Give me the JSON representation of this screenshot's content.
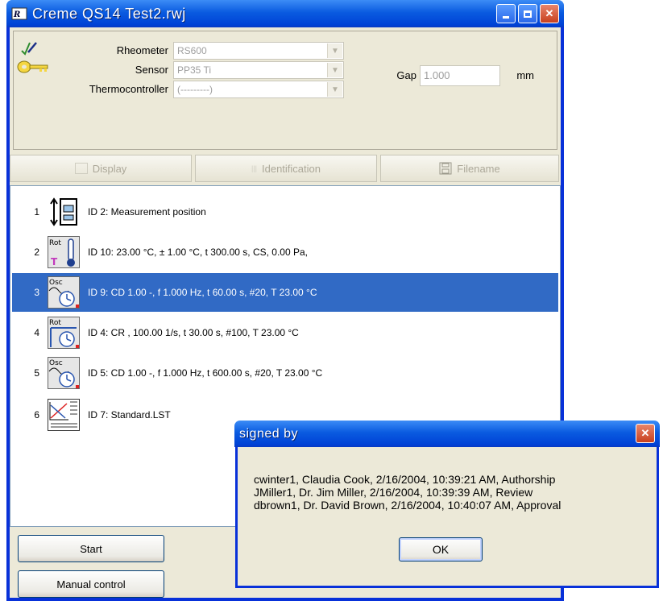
{
  "window": {
    "title": "Creme QS14 Test2.rwj"
  },
  "settings": {
    "rheometer_label": "Rheometer",
    "rheometer_value": "RS600",
    "sensor_label": "Sensor",
    "sensor_value": "PP35 Ti",
    "thermo_label": "Thermocontroller",
    "thermo_value": "(---------)",
    "gap_label": "Gap",
    "gap_value": "1.000",
    "gap_unit": "mm"
  },
  "toolbar": {
    "display": "Display",
    "identification": "Identification",
    "filename": "Filename"
  },
  "steps": [
    {
      "num": "1",
      "text": "ID 2: Measurement position",
      "icon": "measurement-position-icon"
    },
    {
      "num": "2",
      "text": "ID 10: 23.00 °C, ± 1.00 °C, t 300.00 s, CS, 0.00 Pa,",
      "icon": "temperature-icon",
      "icon_label": "Rot"
    },
    {
      "num": "3",
      "text": "ID 9: CD 1.00 -, f 1.000 Hz, t 60.00 s, #20, T 23.00 °C",
      "icon": "oscillation-icon",
      "icon_label": "Osc",
      "selected": true
    },
    {
      "num": "4",
      "text": "ID 4: CR , 100.00 1/s, t 30.00 s, #100, T 23.00 °C",
      "icon": "rotation-icon",
      "icon_label": "Rot"
    },
    {
      "num": "5",
      "text": "ID 5: CD 1.00 -, f 1.000 Hz, t 600.00 s, #20, T 23.00 °C",
      "icon": "oscillation-icon",
      "icon_label": "Osc"
    },
    {
      "num": "6",
      "text": "ID 7: Standard.LST",
      "icon": "report-icon"
    }
  ],
  "buttons": {
    "start": "Start",
    "manual": "Manual control"
  },
  "dialog": {
    "title": "signed by",
    "lines": [
      "cwinter1, Claudia Cook, 2/16/2004, 10:39:21 AM, Authorship",
      "JMiller1, Dr. Jim Miller, 2/16/2004, 10:39:39 AM, Review",
      "dbrown1, Dr. David Brown, 2/16/2004, 10:40:07 AM, Approval"
    ],
    "ok": "OK"
  },
  "colors": {
    "selection": "#316ac5",
    "titlebar": "#0a5be0",
    "face": "#ece9d8"
  }
}
